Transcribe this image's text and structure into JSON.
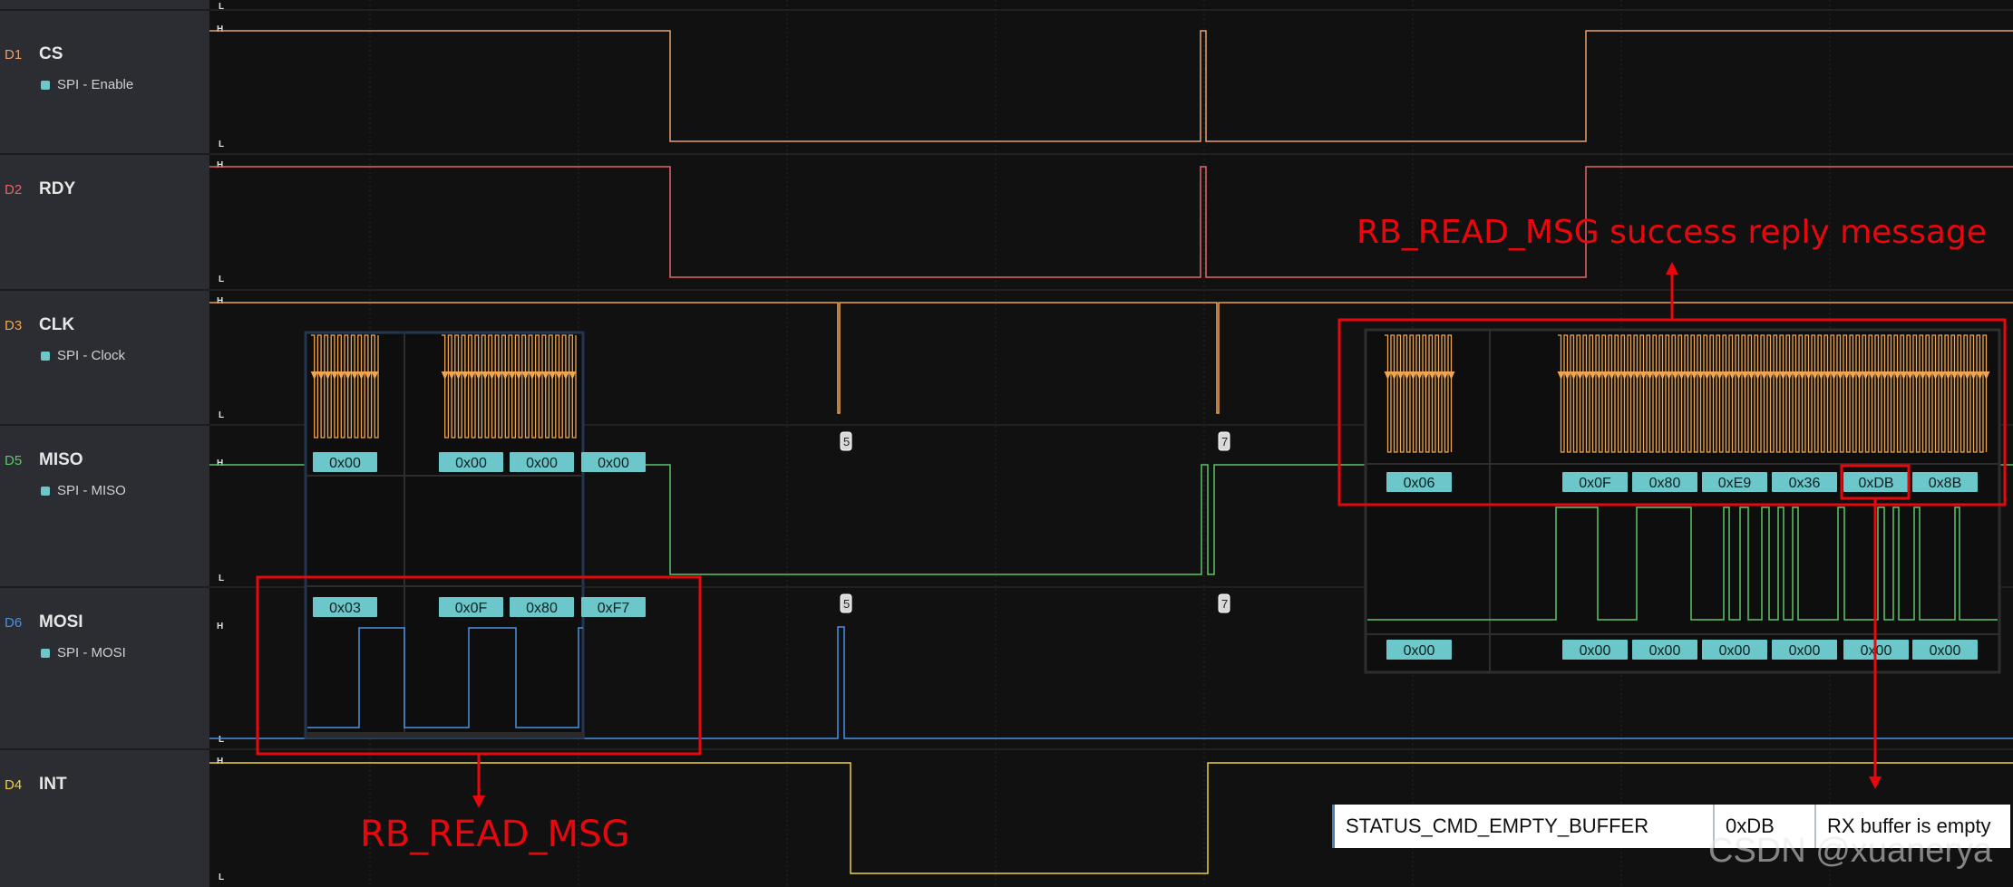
{
  "channels": [
    {
      "id": "D1",
      "name": "CS",
      "analyzer": "SPI - Enable",
      "color": "#e8a070"
    },
    {
      "id": "D2",
      "name": "RDY",
      "analyzer": "",
      "color": "#e8646a"
    },
    {
      "id": "D3",
      "name": "CLK",
      "analyzer": "SPI - Clock",
      "color": "#f0a650"
    },
    {
      "id": "D5",
      "name": "MISO",
      "analyzer": "SPI - MISO",
      "color": "#5ec46a"
    },
    {
      "id": "D6",
      "name": "MOSI",
      "analyzer": "SPI - MOSI",
      "color": "#4a90e2"
    },
    {
      "id": "D4",
      "name": "INT",
      "analyzer": "",
      "color": "#f0d040"
    }
  ],
  "level_labels": {
    "high": "H",
    "low": "L"
  },
  "markers": {
    "m5": "5",
    "m7": "7"
  },
  "left_inset": {
    "miso_bytes": [
      "0x00",
      "0x00",
      "0x00",
      "0x00"
    ],
    "mosi_bytes": [
      "0x03",
      "0x0F",
      "0x80",
      "0xF7"
    ]
  },
  "right_inset": {
    "miso_bytes": [
      "0x06",
      "0x0F",
      "0x80",
      "0xE9",
      "0x36",
      "0xDB",
      "0x8B"
    ],
    "mosi_bytes": [
      "0x00",
      "0x00",
      "0x00",
      "0x00",
      "0x00",
      "0x00",
      "0x00"
    ]
  },
  "annotations": {
    "reply_label": "RB_READ_MSG success reply message",
    "command_label": "RB_READ_MSG"
  },
  "status_table": {
    "name": "STATUS_CMD_EMPTY_BUFFER",
    "code": "0xDB",
    "description": "RX buffer is empty"
  },
  "watermark": "CSDN @xuanerya",
  "colors": {
    "badge_bg": "#6bc7c9",
    "annotation_red": "#e8070d",
    "sidebar_bg": "#2b2d33",
    "plot_bg": "#111111"
  }
}
